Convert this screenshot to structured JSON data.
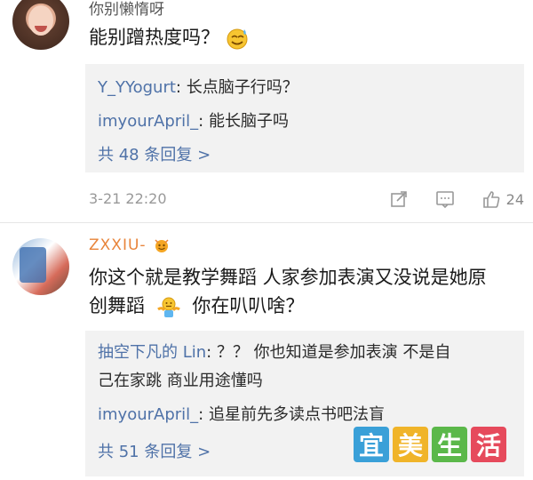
{
  "comments": [
    {
      "username": "你别懒惰呀",
      "text": "能别蹭热度吗？",
      "replies": [
        {
          "user": "Y_YYogurt",
          "text": ": 长点脑子行吗？"
        },
        {
          "user": "imyourApril_",
          "text": ": 能长脑子吗"
        }
      ],
      "more_replies": "共 48 条回复 >",
      "time": "3-21 22:20",
      "like_count": "24"
    },
    {
      "username": "ZXXIU-",
      "text_line1": "你这个就是教学舞蹈 人家参加表演又没说是她原",
      "text_line2": "创舞蹈",
      "text_line2_after": "你在叭叭啥？",
      "replies": [
        {
          "user": "抽空下凡的 Lin",
          "text": ": ？？ 你也知道是参加表演 不是自"
        },
        {
          "user": "",
          "text": "己在家跳 商业用途懂吗"
        },
        {
          "user": "imyourApril_",
          "text": ": 追星前先多读点书吧法盲"
        }
      ],
      "more_replies": "共 51 条回复 >"
    }
  ],
  "watermark": [
    "宜",
    "美",
    "生",
    "活"
  ],
  "colors": {
    "link": "#4f72a8",
    "username_vip": "#e8843a",
    "reply_bg": "#f2f2f2",
    "watermark": [
      "#3aa0d8",
      "#f0b429",
      "#5bb84a",
      "#e64a5c"
    ]
  },
  "icons": [
    "share-icon",
    "comment-icon",
    "like-icon"
  ]
}
